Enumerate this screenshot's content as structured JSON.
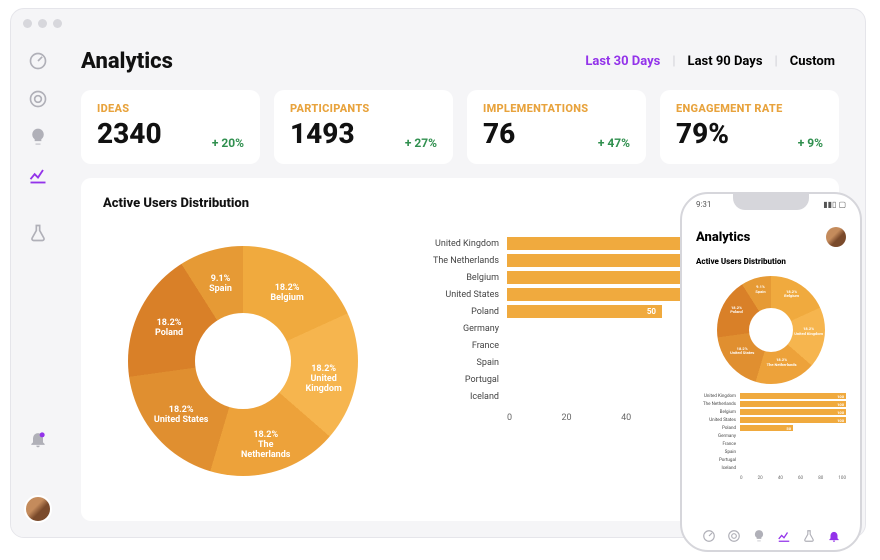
{
  "page_title": "Analytics",
  "date_range": {
    "options": [
      "Last 30 Days",
      "Last 90 Days",
      "Custom"
    ],
    "active": "Last 30 Days"
  },
  "kpis": [
    {
      "label": "IDEAS",
      "value": "2340",
      "delta": "+ 20%"
    },
    {
      "label": "PARTICIPANTS",
      "value": "1493",
      "delta": "+ 27%"
    },
    {
      "label": "IMPLEMENTATIONS",
      "value": "76",
      "delta": "+ 47%"
    },
    {
      "label": "ENGAGEMENT RATE",
      "value": "79%",
      "delta": "+ 9%"
    }
  ],
  "card_title": "Active Users Distribution",
  "chart_data": [
    {
      "type": "pie",
      "title": "Active Users Distribution",
      "slices": [
        {
          "label": "Belgium",
          "pct": 18.2,
          "color": "#f0aa3e"
        },
        {
          "label": "United Kingdom",
          "pct": 18.2,
          "color": "#f6b54e"
        },
        {
          "label": "The Netherlands",
          "pct": 18.2,
          "color": "#eda23a"
        },
        {
          "label": "United States",
          "pct": 18.2,
          "color": "#e08f30"
        },
        {
          "label": "Poland",
          "pct": 18.2,
          "color": "#d98028"
        },
        {
          "label": "Spain",
          "pct": 9.1,
          "color": "#e69a35"
        }
      ]
    },
    {
      "type": "bar",
      "orientation": "horizontal",
      "categories": [
        "United Kingdom",
        "The Netherlands",
        "Belgium",
        "United States",
        "Poland",
        "Germany",
        "France",
        "Spain",
        "Portugal",
        "Iceland"
      ],
      "values": [
        100,
        100,
        100,
        100,
        50,
        0,
        0,
        0,
        0,
        0
      ],
      "xlim": [
        0,
        100
      ],
      "xticks": [
        0,
        20,
        40,
        60,
        80,
        100
      ],
      "bar_color": "#f0aa3e"
    }
  ],
  "sidebar_icons": [
    "gauge-icon",
    "target-icon",
    "bulb-icon",
    "chart-icon",
    "flask-icon"
  ],
  "phone": {
    "time": "9:31",
    "title": "Analytics",
    "sub": "Active Users Distribution",
    "nav_icons": [
      "gauge-icon",
      "target-icon",
      "bulb-icon",
      "chart-icon",
      "flask-icon",
      "bell-icon"
    ]
  }
}
